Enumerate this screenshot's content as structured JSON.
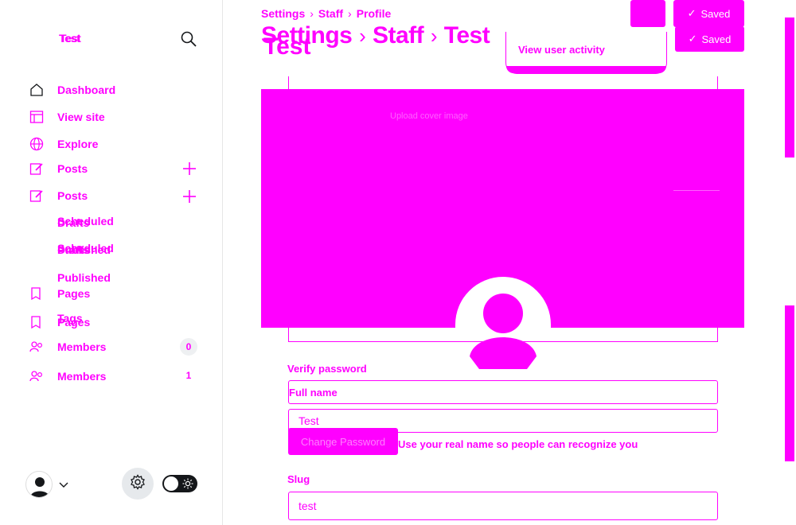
{
  "sidebar": {
    "brand": "Test",
    "nav": [
      {
        "label": "Dashboard",
        "icon": "home-icon"
      },
      {
        "label": "View site",
        "icon": "layout-icon"
      },
      {
        "label": "Explore",
        "icon": "globe-icon"
      },
      {
        "label": "Posts",
        "icon": "pencil-icon"
      },
      {
        "label": "Posts",
        "icon": "pencil-icon"
      },
      {
        "label": "Pages",
        "icon": "page-icon"
      },
      {
        "label": "Pages",
        "icon": "page-icon"
      },
      {
        "label": "Tags",
        "icon": "tag-icon"
      },
      {
        "label": "Members",
        "icon": "members-icon"
      },
      {
        "label": "Members",
        "icon": "members-icon"
      }
    ],
    "sub": [
      "Drafts",
      "Scheduled",
      "Drafts",
      "Published",
      "Scheduled",
      "Published"
    ],
    "counts": [
      "0",
      "1"
    ]
  },
  "header": {
    "breadcrumb": [
      "Settings",
      "Staff",
      "Profile"
    ],
    "title": [
      "Settings",
      "Staff",
      "Test"
    ],
    "title_overlap": "Test",
    "save_label": "Saved",
    "save_label_2": "Saved"
  },
  "dropdown": {
    "item": "View user activity"
  },
  "cover": {
    "faint_text": "Upload cover image"
  },
  "form": {
    "verify_password_label": "Verify password",
    "full_name_label": "Full name",
    "full_name_value": "Test",
    "full_name_hint": "Use your real name so people can recognize you",
    "change_password_label": "Change Password",
    "slug_label": "Slug",
    "slug_value": "test"
  },
  "colors": {
    "accent": "#ff00ff",
    "dark": "#15171a",
    "gear_bg": "#e6e9ec"
  }
}
